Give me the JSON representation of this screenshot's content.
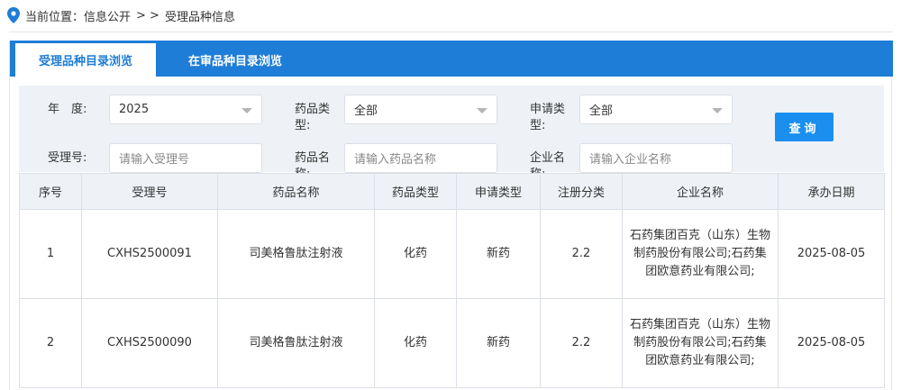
{
  "breadcrumb": {
    "icon": "location-pin-icon",
    "prefix": "当前位置：",
    "section": "信息公开",
    "separator": "> >",
    "current": "受理品种信息"
  },
  "tabs": [
    {
      "label": "受理品种目录浏览",
      "active": true
    },
    {
      "label": "在审品种目录浏览",
      "active": false
    }
  ],
  "filters": {
    "year_label": "年　度:",
    "year_value": "2025",
    "drug_type_label": "药品类型:",
    "drug_type_value": "全部",
    "apply_type_label": "申请类型:",
    "apply_type_value": "全部",
    "accept_no_label": "受理号:",
    "accept_no_placeholder": "请输入受理号",
    "drug_name_label": "药品名称:",
    "drug_name_placeholder": "请输入药品名称",
    "company_label": "企业名称:",
    "company_placeholder": "请输入企业名称",
    "query_button": "查询"
  },
  "table": {
    "headers": [
      "序号",
      "受理号",
      "药品名称",
      "药品类型",
      "申请类型",
      "注册分类",
      "企业名称",
      "承办日期"
    ],
    "rows": [
      [
        "1",
        "CXHS2500091",
        "司美格鲁肽注射液",
        "化药",
        "新药",
        "2.2",
        "石药集团百克（山东）生物制药股份有限公司;石药集团欧意药业有限公司;",
        "2025-08-05"
      ],
      [
        "2",
        "CXHS2500090",
        "司美格鲁肽注射液",
        "化药",
        "新药",
        "2.2",
        "石药集团百克（山东）生物制药股份有限公司;石药集团欧意药业有限公司;",
        "2025-08-05"
      ]
    ]
  },
  "colors": {
    "tab_bar": "#1e7dd7",
    "button": "#1a8ff0",
    "filter_bg": "#eef2f6"
  }
}
